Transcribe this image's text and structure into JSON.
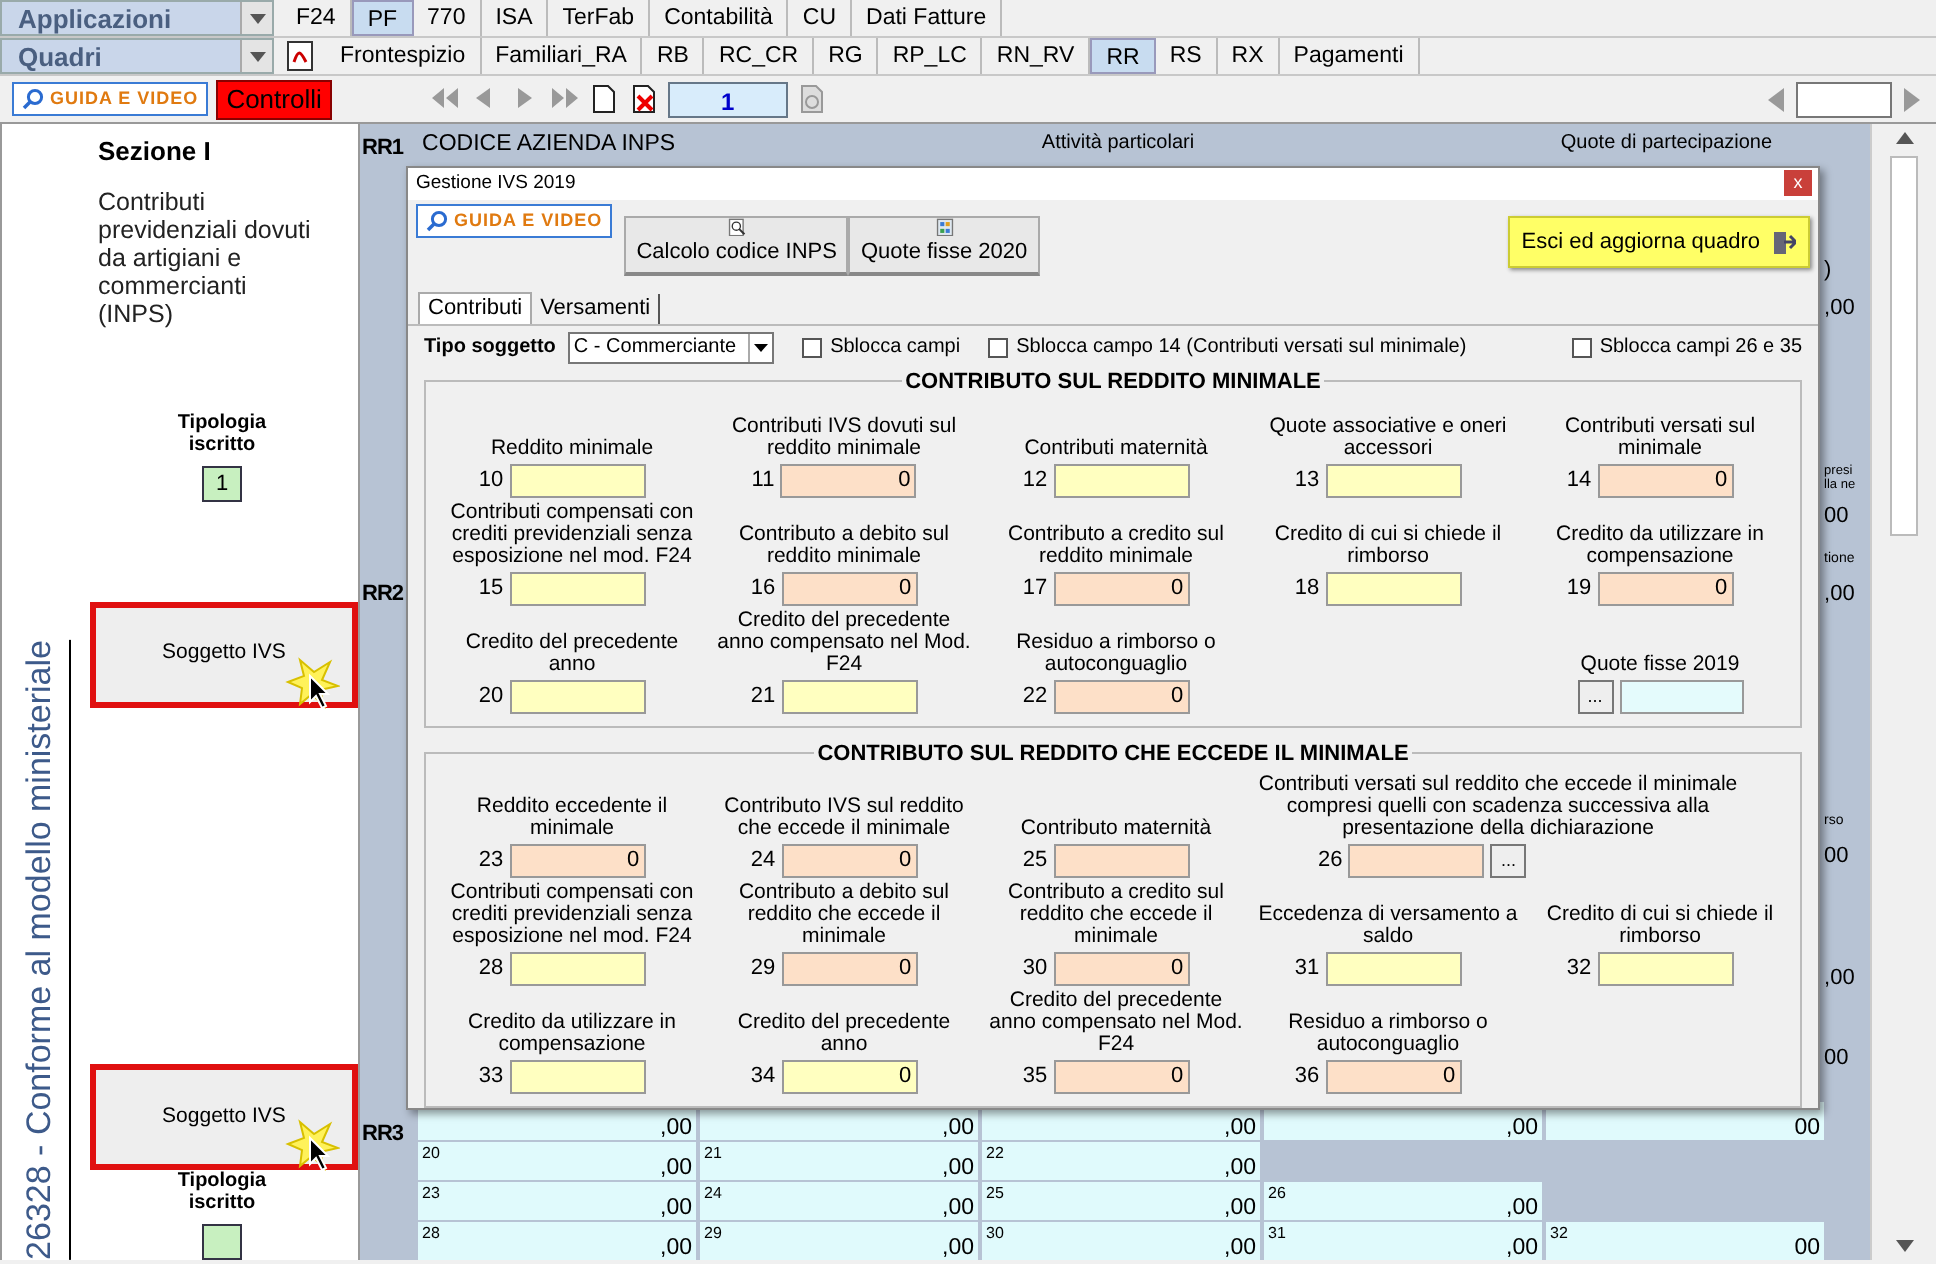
{
  "menu_bar": {
    "selector": "Applicazioni",
    "tabs": [
      {
        "label": "F24",
        "selected": false
      },
      {
        "label": "PF",
        "selected": true
      },
      {
        "label": "770",
        "selected": false
      },
      {
        "label": "ISA",
        "selected": false
      },
      {
        "label": "TerFab",
        "selected": false
      },
      {
        "label": "Contabilità",
        "selected": false
      },
      {
        "label": "CU",
        "selected": false
      },
      {
        "label": "Dati Fatture",
        "selected": false
      }
    ]
  },
  "quadri_bar": {
    "selector": "Quadri",
    "tabs": [
      {
        "label": "Frontespizio",
        "selected": false
      },
      {
        "label": "Familiari_RA",
        "selected": false
      },
      {
        "label": "RB",
        "selected": false
      },
      {
        "label": "RC_CR",
        "selected": false
      },
      {
        "label": "RG",
        "selected": false
      },
      {
        "label": "RP_LC",
        "selected": false
      },
      {
        "label": "RN_RV",
        "selected": false
      },
      {
        "label": "RR",
        "selected": true
      },
      {
        "label": "RS",
        "selected": false
      },
      {
        "label": "RX",
        "selected": false
      },
      {
        "label": "Pagamenti",
        "selected": false
      }
    ]
  },
  "toolbar": {
    "guide": "GUIDA E VIDEO",
    "controls": "Controlli",
    "page": "1"
  },
  "sidebar": {
    "title": "Sezione I",
    "description": "Contributi previdenziali dovuti da artigiani e commercianti (INPS)",
    "caption": "26328 - Conforme al modello ministeriale",
    "items": [
      {
        "kind": "tipologia",
        "label": "Tipologia iscritto",
        "value": "1"
      },
      {
        "kind": "button",
        "label": "Soggetto IVS",
        "highlighted": true
      },
      {
        "kind": "button",
        "label": "Soggetto IVS",
        "highlighted": true
      },
      {
        "kind": "tipologia",
        "label": "Tipologia iscritto"
      }
    ]
  },
  "form": {
    "codes": [
      "RR1",
      "RR2",
      "RR3"
    ],
    "header": [
      "CODICE AZIENDA INPS",
      "Attività particolari",
      "Quote di partecipazione"
    ],
    "edge_fragments": [
      ")",
      ",00",
      "presi lla ne",
      "00",
      "tione",
      ",00",
      "rso",
      "00",
      ",00",
      "00"
    ],
    "rows": [
      [
        {
          "value": ",00"
        },
        {
          "value": ",00"
        },
        {
          "value": ",00"
        },
        {
          "value": ",00"
        },
        {
          "value": "00"
        }
      ],
      [
        {
          "number": "20",
          "value": ",00"
        },
        {
          "number": "21",
          "value": ",00"
        },
        {
          "number": "22",
          "value": ",00"
        }
      ],
      [
        {
          "number": "23",
          "value": ",00"
        },
        {
          "number": "24",
          "value": ",00"
        },
        {
          "number": "25",
          "value": ",00"
        },
        {
          "number": "26",
          "value": ",00"
        }
      ],
      [
        {
          "number": "28",
          "value": ",00"
        },
        {
          "number": "29",
          "value": ",00"
        },
        {
          "number": "30",
          "value": ",00"
        },
        {
          "number": "31",
          "value": ",00"
        },
        {
          "number": "32",
          "value": "00"
        }
      ]
    ]
  },
  "dialog": {
    "title": "Gestione IVS 2019",
    "close": "x",
    "guide": "GUIDA E VIDEO",
    "buttons": [
      {
        "label": "Calcolo codice INPS",
        "kind": "search"
      },
      {
        "label": "Quote fisse 2020",
        "kind": "grid"
      }
    ],
    "exit": "Esci ed aggiorna quadro",
    "tabs": [
      {
        "label": "Contributi",
        "selected": true
      },
      {
        "label": "Versamenti",
        "selected": false
      }
    ],
    "tipo": {
      "label": "Tipo soggetto",
      "value": "C - Commerciante"
    },
    "checks": [
      {
        "label": "Sblocca campi",
        "checked": false
      },
      {
        "label": "Sblocca campo 14 (Contributi versati sul minimale)",
        "checked": false
      },
      {
        "label": "Sblocca campi 26 e 35",
        "checked": false
      }
    ],
    "sections": [
      {
        "title": "CONTRIBUTO SUL REDDITO MINIMALE",
        "fields": [
          {
            "number": "10",
            "label": "Reddito minimale",
            "editable": true,
            "kind": "plain"
          },
          {
            "number": "11",
            "label": "Contributi IVS dovuti sul reddito minimale",
            "editable": false,
            "kind": "plain",
            "value": "0"
          },
          {
            "number": "12",
            "label": "Contributi maternità",
            "editable": true,
            "kind": "plain"
          },
          {
            "number": "13",
            "label": "Quote associative e oneri accessori",
            "editable": true,
            "kind": "plain"
          },
          {
            "number": "14",
            "label": "Contributi versati sul minimale",
            "editable": false,
            "kind": "plain",
            "value": "0"
          },
          {
            "number": "15",
            "label": "Contributi compensati con crediti previdenziali senza esposizione nel mod. F24",
            "editable": true,
            "kind": "plain"
          },
          {
            "number": "16",
            "label": "Contributo a debito sul reddito minimale",
            "editable": false,
            "kind": "plain",
            "value": "0"
          },
          {
            "number": "17",
            "label": "Contributo a credito sul reddito minimale",
            "editable": false,
            "kind": "plain",
            "value": "0"
          },
          {
            "number": "18",
            "label": "Credito di cui si chiede il rimborso",
            "editable": true,
            "kind": "plain"
          },
          {
            "number": "19",
            "label": "Credito da utilizzare in compensazione",
            "editable": false,
            "kind": "plain",
            "value": "0"
          },
          {
            "number": "20",
            "label": "Credito del precedente anno",
            "editable": true,
            "kind": "plain"
          },
          {
            "number": "21",
            "label": "Credito del precedente anno compensato nel Mod. F24",
            "editable": true,
            "kind": "plain"
          },
          {
            "number": "22",
            "label": "Residuo a rimborso o autoconguaglio",
            "editable": false,
            "kind": "plain",
            "value": "0"
          },
          {
            "label": "Quote fisse 2019",
            "kind": "lookup_before",
            "button": "..."
          }
        ]
      },
      {
        "title": "CONTRIBUTO SUL REDDITO CHE ECCEDE IL MINIMALE",
        "fields": [
          {
            "number": "23",
            "label": "Reddito eccedente il minimale",
            "editable": false,
            "kind": "plain",
            "value": "0"
          },
          {
            "number": "24",
            "label": "Contributo IVS sul reddito che eccede il minimale",
            "editable": false,
            "kind": "plain",
            "value": "0"
          },
          {
            "number": "25",
            "label": "Contributo maternità",
            "editable": false,
            "kind": "plain"
          },
          {
            "number": "26",
            "label": "Contributi versati sul reddito che eccede il minimale compresi quelli con scadenza successiva alla presentazione della dichiarazione",
            "editable": false,
            "kind": "lookup_after",
            "button": "..."
          },
          {
            "number": "28",
            "label": "Contributi compensati con crediti previdenziali senza esposizione nel mod. F24",
            "editable": true,
            "kind": "plain"
          },
          {
            "number": "29",
            "label": "Contributo a debito sul reddito che eccede il minimale",
            "editable": false,
            "kind": "plain",
            "value": "0"
          },
          {
            "number": "30",
            "label": "Contributo a credito sul reddito che eccede il minimale",
            "editable": false,
            "kind": "plain",
            "value": "0"
          },
          {
            "number": "31",
            "label": "Eccedenza di versamento a saldo",
            "editable": true,
            "kind": "plain"
          },
          {
            "number": "32",
            "label": "Credito di cui si chiede il rimborso",
            "editable": true,
            "kind": "plain"
          },
          {
            "number": "33",
            "label": "Credito da utilizzare in compensazione",
            "editable": true,
            "kind": "plain"
          },
          {
            "number": "34",
            "label": "Credito del precedente anno",
            "editable": true,
            "kind": "plain",
            "value": "0"
          },
          {
            "number": "35",
            "label": "Credito del precedente anno compensato nel Mod. F24",
            "editable": false,
            "kind": "plain",
            "value": "0"
          },
          {
            "number": "36",
            "label": "Residuo a rimborso o autoconguaglio",
            "editable": false,
            "kind": "plain",
            "value": "0"
          }
        ]
      }
    ]
  }
}
